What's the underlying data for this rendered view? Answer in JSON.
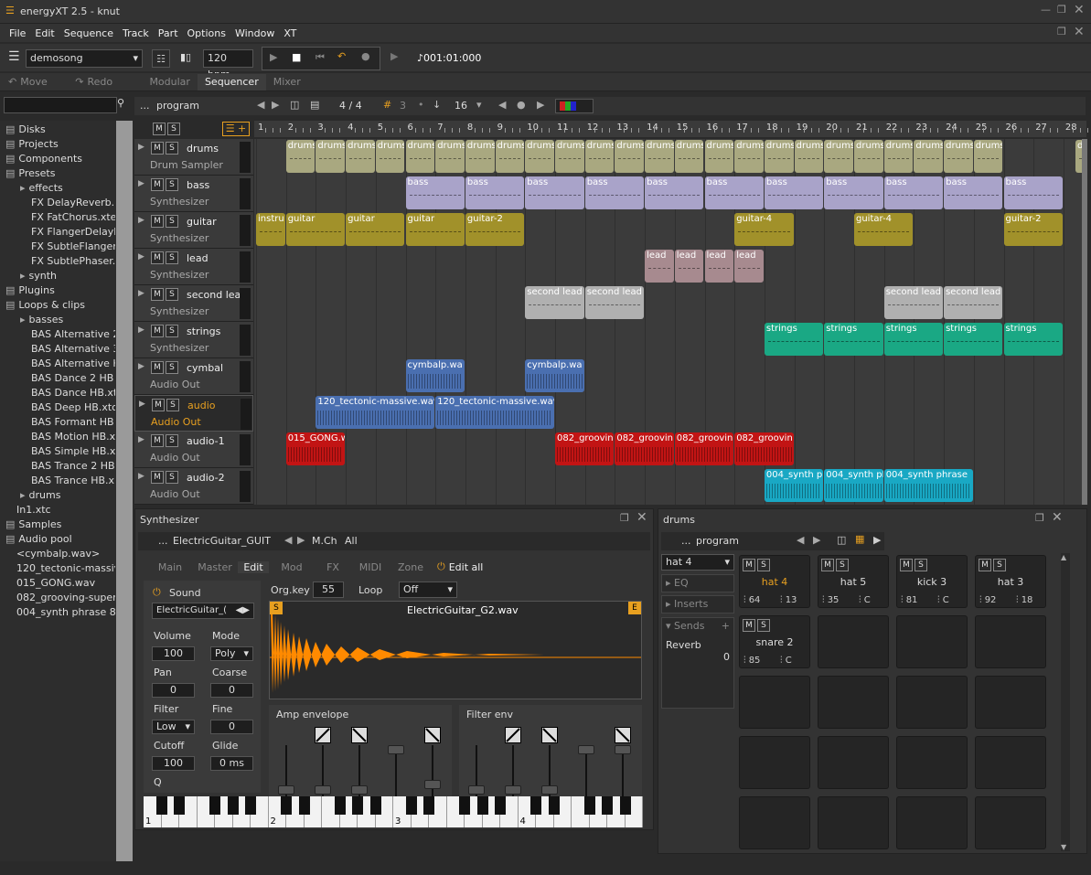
{
  "window": {
    "title": "energyXT 2.5 - knut"
  },
  "menu": [
    "File",
    "Edit",
    "Sequence",
    "Track",
    "Part",
    "Options",
    "Window",
    "XT"
  ],
  "toolbar": {
    "song": "demosong",
    "tempo": "120 bpm",
    "position": "♪001:01:000"
  },
  "toolbar2": {
    "move": "Move",
    "redo": "Redo",
    "tabs": [
      "Modular",
      "Sequencer",
      "Mixer"
    ]
  },
  "seqbar": {
    "ellipsis": "...",
    "program": "program",
    "timesig": "4 / 4",
    "grid": "3",
    "quant": "16"
  },
  "browser": {
    "items": [
      {
        "label": "Disks",
        "indent": 0
      },
      {
        "label": "Projects",
        "indent": 0
      },
      {
        "label": "Components",
        "indent": 0
      },
      {
        "label": "Presets",
        "indent": 0
      },
      {
        "label": "effects",
        "indent": 2
      },
      {
        "label": "FX DelayReverb.:",
        "indent": 3
      },
      {
        "label": "FX FatChorus.xte",
        "indent": 3
      },
      {
        "label": "FX FlangerDelayF",
        "indent": 3
      },
      {
        "label": "FX SubtleFlanger",
        "indent": 3
      },
      {
        "label": "FX SubtlePhaser.:",
        "indent": 3
      },
      {
        "label": "synth",
        "indent": 2
      },
      {
        "label": "Plugins",
        "indent": 0
      },
      {
        "label": "Loops & clips",
        "indent": 0
      },
      {
        "label": "basses",
        "indent": 2
      },
      {
        "label": "BAS Alternative 2",
        "indent": 3
      },
      {
        "label": "BAS Alternative 3",
        "indent": 3
      },
      {
        "label": "BAS Alternative H",
        "indent": 3
      },
      {
        "label": "BAS Dance 2 HB",
        "indent": 3
      },
      {
        "label": "BAS Dance HB.xt",
        "indent": 3
      },
      {
        "label": "BAS Deep HB.xtc",
        "indent": 3
      },
      {
        "label": "BAS Formant HB",
        "indent": 3
      },
      {
        "label": "BAS Motion HB.x",
        "indent": 3
      },
      {
        "label": "BAS Simple HB.x",
        "indent": 3
      },
      {
        "label": "BAS Trance 2 HB",
        "indent": 3
      },
      {
        "label": "BAS Trance HB.x",
        "indent": 3
      },
      {
        "label": "drums",
        "indent": 2
      },
      {
        "label": "In1.xtc",
        "indent": 1
      },
      {
        "label": "Samples",
        "indent": 0
      },
      {
        "label": "Audio pool",
        "indent": 0
      },
      {
        "label": "<cymbalp.wav>",
        "indent": 1
      },
      {
        "label": "120_tectonic-massiv",
        "indent": 1
      },
      {
        "label": "015_GONG.wav",
        "indent": 1
      },
      {
        "label": "082_grooving-super",
        "indent": 1
      },
      {
        "label": "004_synth phrase 8",
        "indent": 1
      }
    ]
  },
  "ruler": [
    "1",
    "2",
    "3",
    "4",
    "5",
    "6",
    "7",
    "8",
    "9",
    "10",
    "11",
    "12",
    "13",
    "14",
    "15",
    "16",
    "17",
    "18",
    "19",
    "20",
    "21",
    "22",
    "23",
    "24",
    "25",
    "26",
    "27",
    "28"
  ],
  "tracks": [
    {
      "name": "drums",
      "sub": "Drum Sampler"
    },
    {
      "name": "bass",
      "sub": "Synthesizer"
    },
    {
      "name": "guitar",
      "sub": "Synthesizer"
    },
    {
      "name": "lead",
      "sub": "Synthesizer"
    },
    {
      "name": "second lead",
      "sub": "Synthesizer"
    },
    {
      "name": "strings",
      "sub": "Synthesizer"
    },
    {
      "name": "cymbal",
      "sub": "Audio Out"
    },
    {
      "name": "audio",
      "sub": "Audio Out"
    },
    {
      "name": "audio-1",
      "sub": "Audio Out"
    },
    {
      "name": "audio-2",
      "sub": "Audio Out"
    }
  ],
  "clip_labels": {
    "drums": "drums",
    "bass": "bass",
    "guitar": "guitar",
    "guitar2": "guitar-2",
    "guitar4": "guitar-4",
    "instru": "instru",
    "lead": "lead",
    "second": "second lead",
    "strings": "strings",
    "cymbal": "cymbalp.wa",
    "cymbal2": "cymbalp.wa",
    "tect": "120_tectonic-massive.wav",
    "gong": "015_GONG.w",
    "groove": "082_groovin",
    "synth": "004_synth pl",
    "synthp": "004_synth phrase"
  },
  "colors": {
    "drums": "#a9a880",
    "bass": "#a9a3c9",
    "guitar": "#a1912a",
    "lead": "#a78a8f",
    "second": "#b0b0b0",
    "strings": "#1aa884",
    "cymbal": "#4a6fb0",
    "audio": "#4a6fb0",
    "gong": "#c21414",
    "synth": "#19a8c4"
  },
  "synth": {
    "title": "Synthesizer",
    "preset": "ElectricGuitar_GUIT",
    "mch": "M.Ch",
    "all": "All",
    "tabs": [
      "Main",
      "Master",
      "Edit",
      "Mod",
      "FX",
      "MIDI",
      "Zone"
    ],
    "editall": "Edit all",
    "sound": "Sound",
    "soundval": "ElectricGuitar_(",
    "volume": "Volume",
    "volval": "100",
    "mode": "Mode",
    "modeval": "Poly",
    "pan": "Pan",
    "panval": "0",
    "coarse": "Coarse",
    "coarseval": "0",
    "filter": "Filter",
    "filterval": "Low",
    "fine": "Fine",
    "fineval": "0",
    "cutoff": "Cutoff",
    "cutoffval": "100",
    "glide": "Glide",
    "glideval": "0 ms",
    "q": "Q",
    "orgkey": "Org.key",
    "orgkeyval": "55",
    "loop": "Loop",
    "loopval": "Off",
    "wave": "ElectricGuitar_G2.wav",
    "s": "S",
    "e": "E",
    "ampenv": "Amp envelope",
    "filterenv": "Filter env",
    "keys": [
      "1",
      "2",
      "3",
      "4"
    ]
  },
  "drums": {
    "title": "drums",
    "program": "program",
    "hat": "hat 4",
    "eq": "EQ",
    "inserts": "Inserts",
    "sends": "Sends",
    "reverb": "Reverb",
    "reverbval": "0",
    "pads": [
      {
        "name": "hat 4",
        "v": "64",
        "p": "13",
        "c": "",
        "active": true
      },
      {
        "name": "hat 5",
        "v": "35",
        "p": "C",
        "c": ""
      },
      {
        "name": "kick 3",
        "v": "81",
        "p": "C",
        "c": ""
      },
      {
        "name": "hat 3",
        "v": "92",
        "p": "18",
        "c": ""
      },
      {
        "name": "snare 2",
        "v": "85",
        "p": "C",
        "c": ""
      }
    ]
  }
}
